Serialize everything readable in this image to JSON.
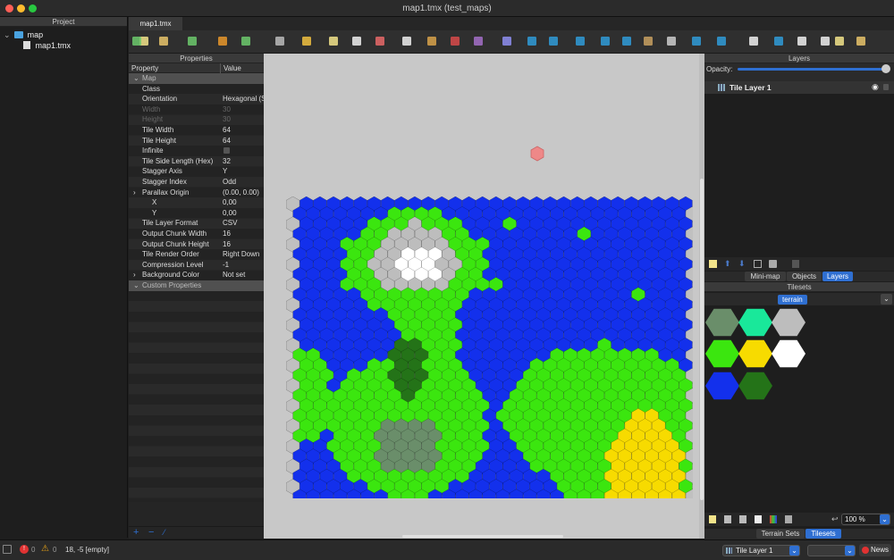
{
  "window": {
    "title": "map1.tmx (test_maps)"
  },
  "project": {
    "title": "Project",
    "items": [
      {
        "label": "map"
      },
      {
        "label": "map1.tmx"
      }
    ]
  },
  "tabs": [
    {
      "label": "map1.tmx"
    }
  ],
  "toolbar": {
    "tools": [
      "new-file",
      "open",
      "export",
      "undo",
      "redo",
      "edit-commands",
      "stamp-brush",
      "terrain-brush",
      "bucket-fill",
      "shape-fill",
      "eraser",
      "rectangle-select",
      "magic-wand",
      "select-same-tile",
      "random-mode",
      "wang-fill",
      "object-select",
      "edit-polygons",
      "insert-rectangle",
      "insert-point",
      "insert-ellipse",
      "insert-polygon",
      "insert-tile",
      "insert-text",
      "world-tool",
      "move",
      "dice",
      "stamp",
      "flip-horizontal",
      "flip-vertical",
      "more"
    ]
  },
  "properties": {
    "title": "Properties",
    "col_property": "Property",
    "col_value": "Value",
    "rows": [
      {
        "k": "Map",
        "v": "",
        "type": "group"
      },
      {
        "k": "Class",
        "v": ""
      },
      {
        "k": "Orientation",
        "v": "Hexagonal (S"
      },
      {
        "k": "Width",
        "v": "30",
        "type": "dim"
      },
      {
        "k": "Height",
        "v": "30",
        "type": "dim"
      },
      {
        "k": "Tile Width",
        "v": "64"
      },
      {
        "k": "Tile Height",
        "v": "64"
      },
      {
        "k": "Infinite",
        "v": "",
        "checkbox": true
      },
      {
        "k": "Tile Side Length (Hex)",
        "v": "32"
      },
      {
        "k": "Stagger Axis",
        "v": "Y"
      },
      {
        "k": "Stagger Index",
        "v": "Odd"
      },
      {
        "k": "Parallax Origin",
        "v": "(0.00, 0.00)",
        "expand": true
      },
      {
        "k": "X",
        "v": "0,00",
        "indent": true
      },
      {
        "k": "Y",
        "v": "0,00",
        "indent": true
      },
      {
        "k": "Tile Layer Format",
        "v": "CSV"
      },
      {
        "k": "Output Chunk Width",
        "v": "16"
      },
      {
        "k": "Output Chunk Height",
        "v": "16"
      },
      {
        "k": "Tile Render Order",
        "v": "Right Down"
      },
      {
        "k": "Compression Level",
        "v": "-1"
      },
      {
        "k": "Background Color",
        "v": "Not set",
        "expand": true
      },
      {
        "k": "Custom Properties",
        "v": "",
        "type": "group"
      }
    ]
  },
  "layers": {
    "title": "Layers",
    "opacity_label": "Opacity:",
    "opacity": 1.0,
    "items": [
      {
        "label": "Tile Layer 1"
      }
    ],
    "tabs": [
      "Mini-map",
      "Objects",
      "Layers"
    ],
    "active_tab": "Layers"
  },
  "tilesets": {
    "title": "Tilesets",
    "active": "terrain",
    "zoom": "100 %",
    "tabs": [
      "Terrain Sets",
      "Tilesets"
    ],
    "active_tab": "Tilesets",
    "tiles": [
      "#6a8e6a",
      "#19e89a",
      "#bdbdbd",
      "#3be60f",
      "#f7db00",
      "#ffffff",
      "#1330ec",
      "#247318"
    ]
  },
  "status": {
    "errors": "0",
    "warnings": "0",
    "coords": "18, -5 [empty]",
    "layer": "Tile Layer 1",
    "news": "News"
  },
  "colors": {
    "water": "#1330ec",
    "grass": "#3be60f",
    "rock": "#bdbdbd",
    "snow": "#ffffff",
    "sand": "#f7db00",
    "forest": "#247318",
    "swamp": "#6a8e6a",
    "accent": "#2f6fd1"
  }
}
